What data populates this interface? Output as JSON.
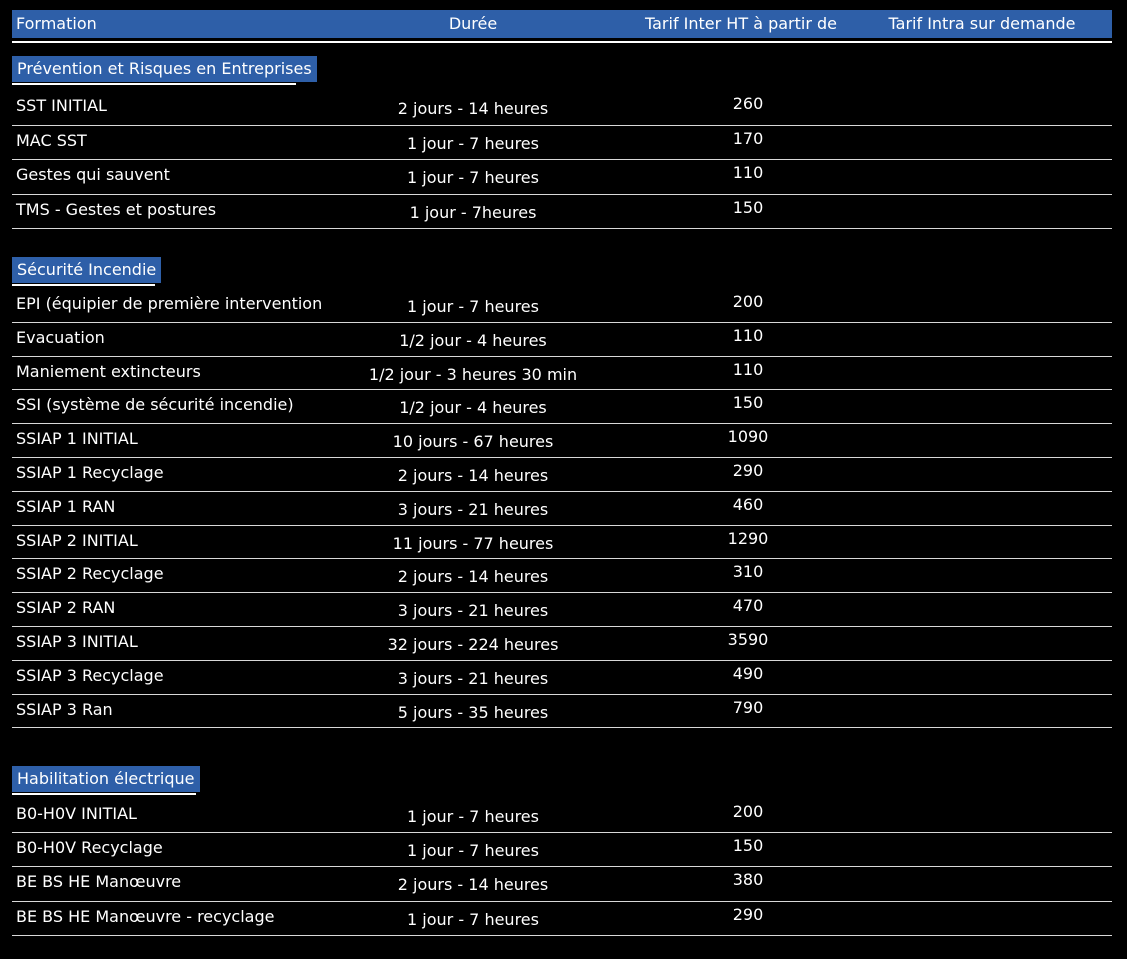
{
  "header": {
    "formation": "Formation",
    "duree": "Durée",
    "tarif_inter": "Tarif Inter HT à partir de",
    "tarif_intra": "Tarif Intra sur demande"
  },
  "colors": {
    "background": "#000000",
    "accent_blue": "#2e5fa8",
    "text": "#ffffff"
  },
  "sections": [
    {
      "title": "Prévention et Risques en Entreprises",
      "rows": [
        {
          "formation": "SST INITIAL",
          "duree": "2 jours - 14 heures",
          "tarif": "260"
        },
        {
          "formation": "MAC SST",
          "duree": "1 jour - 7 heures",
          "tarif": "170"
        },
        {
          "formation": "Gestes qui sauvent",
          "duree": "1 jour - 7 heures",
          "tarif": "110"
        },
        {
          "formation": "TMS - Gestes et postures",
          "duree": "1 jour - 7heures",
          "tarif": "150"
        }
      ]
    },
    {
      "title": "Sécurité Incendie",
      "rows": [
        {
          "formation": "EPI (équipier de première intervention",
          "duree": "1 jour - 7 heures",
          "tarif": "200"
        },
        {
          "formation": "Evacuation",
          "duree": "1/2 jour - 4 heures",
          "tarif": "110"
        },
        {
          "formation": "Maniement extincteurs",
          "duree": "1/2 jour - 3 heures 30 min",
          "tarif": "110"
        },
        {
          "formation": "SSI (système de sécurité incendie)",
          "duree": "1/2 jour - 4 heures",
          "tarif": "150"
        },
        {
          "formation": "SSIAP 1 INITIAL",
          "duree": "10 jours - 67 heures",
          "tarif": "1090"
        },
        {
          "formation": "SSIAP 1 Recyclage",
          "duree": "2 jours - 14 heures",
          "tarif": "290"
        },
        {
          "formation": "SSIAP 1 RAN",
          "duree": "3 jours - 21 heures",
          "tarif": "460"
        },
        {
          "formation": "SSIAP 2 INITIAL",
          "duree": "11 jours - 77 heures",
          "tarif": "1290"
        },
        {
          "formation": "SSIAP 2 Recyclage",
          "duree": "2 jours - 14 heures",
          "tarif": "310"
        },
        {
          "formation": "SSIAP 2 RAN",
          "duree": "3 jours - 21 heures",
          "tarif": "470"
        },
        {
          "formation": "SSIAP 3 INITIAL",
          "duree": "32 jours - 224 heures",
          "tarif": "3590"
        },
        {
          "formation": "SSIAP 3 Recyclage",
          "duree": "3 jours - 21 heures",
          "tarif": "490"
        },
        {
          "formation": "SSIAP 3 Ran",
          "duree": "5 jours - 35 heures",
          "tarif": "790"
        }
      ]
    },
    {
      "title": "Habilitation électrique",
      "rows": [
        {
          "formation": "B0-H0V INITIAL",
          "duree": "1 jour - 7 heures",
          "tarif": "200"
        },
        {
          "formation": "B0-H0V Recyclage",
          "duree": "1 jour - 7 heures",
          "tarif": "150"
        },
        {
          "formation": "BE BS HE Manœuvre",
          "duree": "2 jours - 14 heures",
          "tarif": "380"
        },
        {
          "formation": "BE BS HE Manœuvre - recyclage",
          "duree": "1 jour - 7 heures",
          "tarif": "290"
        }
      ]
    }
  ]
}
